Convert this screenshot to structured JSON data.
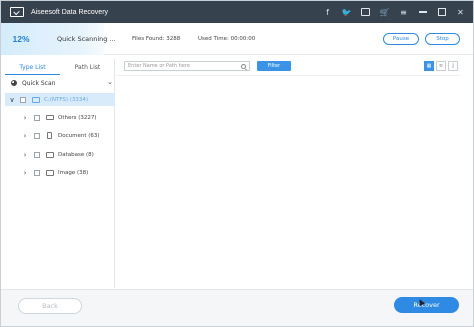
{
  "app": {
    "title": "Aiseesoft Data Recovery"
  },
  "title_icons": [
    "facebook-icon",
    "twitter-icon",
    "feedback-icon",
    "cart-icon",
    "menu-icon",
    "minimize-icon",
    "maximize-icon",
    "close-icon"
  ],
  "title_glyphs": {
    "facebook": "f",
    "twitter": "🐦",
    "feedback": "…",
    "cart": "🛒",
    "menu": "≡",
    "close": "✕"
  },
  "progress": {
    "percent_label": "12%",
    "percent": 12,
    "status": "Quick Scanning ...",
    "files_found": "Files Found: 3288",
    "used_time": "Used Time: 00:00:00",
    "pause_label": "Pause",
    "stop_label": "Stop"
  },
  "left_panel": {
    "tabs": [
      {
        "label": "Type List",
        "active": true
      },
      {
        "label": "Path List",
        "active": false
      }
    ],
    "scan_mode": "Quick Scan",
    "tree": [
      {
        "label": "C:(NTFS) (3334)",
        "arrow": "∨",
        "icon": "drive",
        "selected": true
      },
      {
        "label": "Others (3227)",
        "arrow": "›",
        "icon": "folder"
      },
      {
        "label": "Document (63)",
        "arrow": "›",
        "icon": "doc"
      },
      {
        "label": "Database (8)",
        "arrow": "›",
        "icon": "db"
      },
      {
        "label": "Image (38)",
        "arrow": "›",
        "icon": "image"
      }
    ]
  },
  "main": {
    "search_placeholder": "Enter Name or Path here",
    "filter_label": "Filter",
    "view_modes": [
      "grid-view-icon",
      "list-view-icon",
      "detail-view-icon"
    ]
  },
  "bottom": {
    "back_label": "Back",
    "recover_label": "Recover"
  },
  "colors": {
    "accent": "#2f8ae3",
    "titlebar": "#37424f",
    "selected_row": "#d7ebfb"
  }
}
